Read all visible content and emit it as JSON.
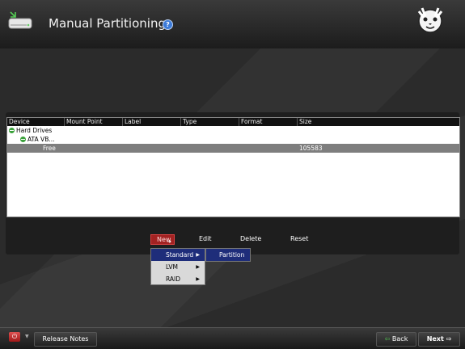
{
  "header": {
    "title": "Manual Partitioning",
    "help_glyph": "?"
  },
  "table": {
    "columns": [
      "Device",
      "Mount Point",
      "Label",
      "Type",
      "Format",
      "Size"
    ],
    "rows": [
      {
        "device": "Hard Drives",
        "mount": "",
        "label": "",
        "type": "",
        "format": "",
        "size": ""
      },
      {
        "device": "ATA VB...",
        "mount": "",
        "label": "",
        "type": "",
        "format": "",
        "size": ""
      },
      {
        "device": "Free",
        "mount": "",
        "label": "",
        "type": "",
        "format": "",
        "size": "105583"
      }
    ]
  },
  "actions": {
    "new": "New",
    "edit": "Edit",
    "delete": "Delete",
    "reset": "Reset"
  },
  "new_menu": {
    "items": [
      "Standard",
      "LVM",
      "RAID"
    ],
    "active": "Standard"
  },
  "standard_submenu": {
    "items": [
      "Partition"
    ]
  },
  "footer": {
    "release_notes": "Release Notes",
    "back": "Back",
    "next": "Next"
  },
  "colors": {
    "accent_red": "#a32222",
    "menu_highlight": "#1e2d7a",
    "selected_row": "#7e7e7e"
  }
}
